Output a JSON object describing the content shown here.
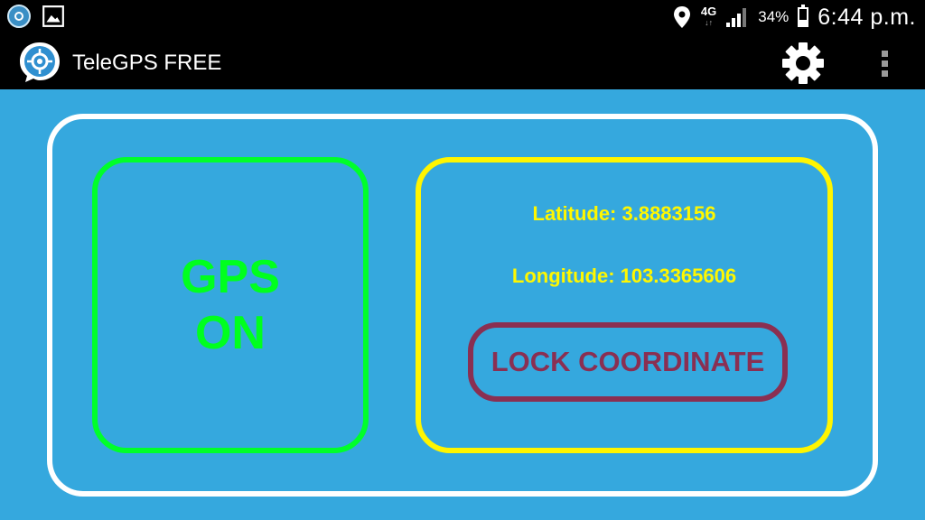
{
  "status_bar": {
    "network_type": "4G",
    "network_arrows": "↓↑",
    "battery_percent": "34%",
    "battery_level": 0.34,
    "time": "6:44 p.m."
  },
  "app_bar": {
    "title": "TeleGPS FREE"
  },
  "gps_panel": {
    "line1": "GPS",
    "line2": "ON",
    "color": "#00ff1e"
  },
  "coordinates": {
    "latitude_label": "Latitude: 3.8883156",
    "longitude_label": "Longitude: 103.3365606",
    "color": "#fff700"
  },
  "lock_button": {
    "label": "LOCK COORDINATE",
    "color": "#8a2f52"
  },
  "colors": {
    "background": "#35a8de",
    "bars": "#000000"
  }
}
